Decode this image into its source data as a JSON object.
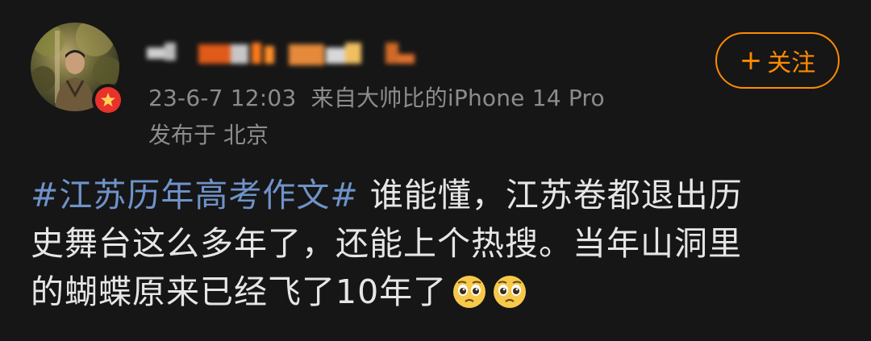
{
  "post": {
    "username_redacted": "",
    "timestamp": "23-6-7 12:03",
    "source_prefix": "来自",
    "source": "大帅比的iPhone 14 Pro",
    "location_prefix": "发布于",
    "location": "北京",
    "follow_label": "关注",
    "follow_icon": "plus-icon",
    "hashtag": "#江苏历年高考作文#",
    "body_line1_rest": " 谁能懂，江苏卷都退出历",
    "body_line2": "史舞台这么多年了，还能上个热搜。当年山洞里",
    "body_line3": "的蝴蝶原来已经飞了10年了",
    "emojis": [
      "pleading-face-emoji",
      "pleading-face-emoji"
    ]
  },
  "colors": {
    "background": "#161616",
    "accent": "#ff8a00",
    "hashtag": "#6f92c8",
    "meta_text": "#8c8c8c",
    "verified_badge": "#e8322a"
  }
}
